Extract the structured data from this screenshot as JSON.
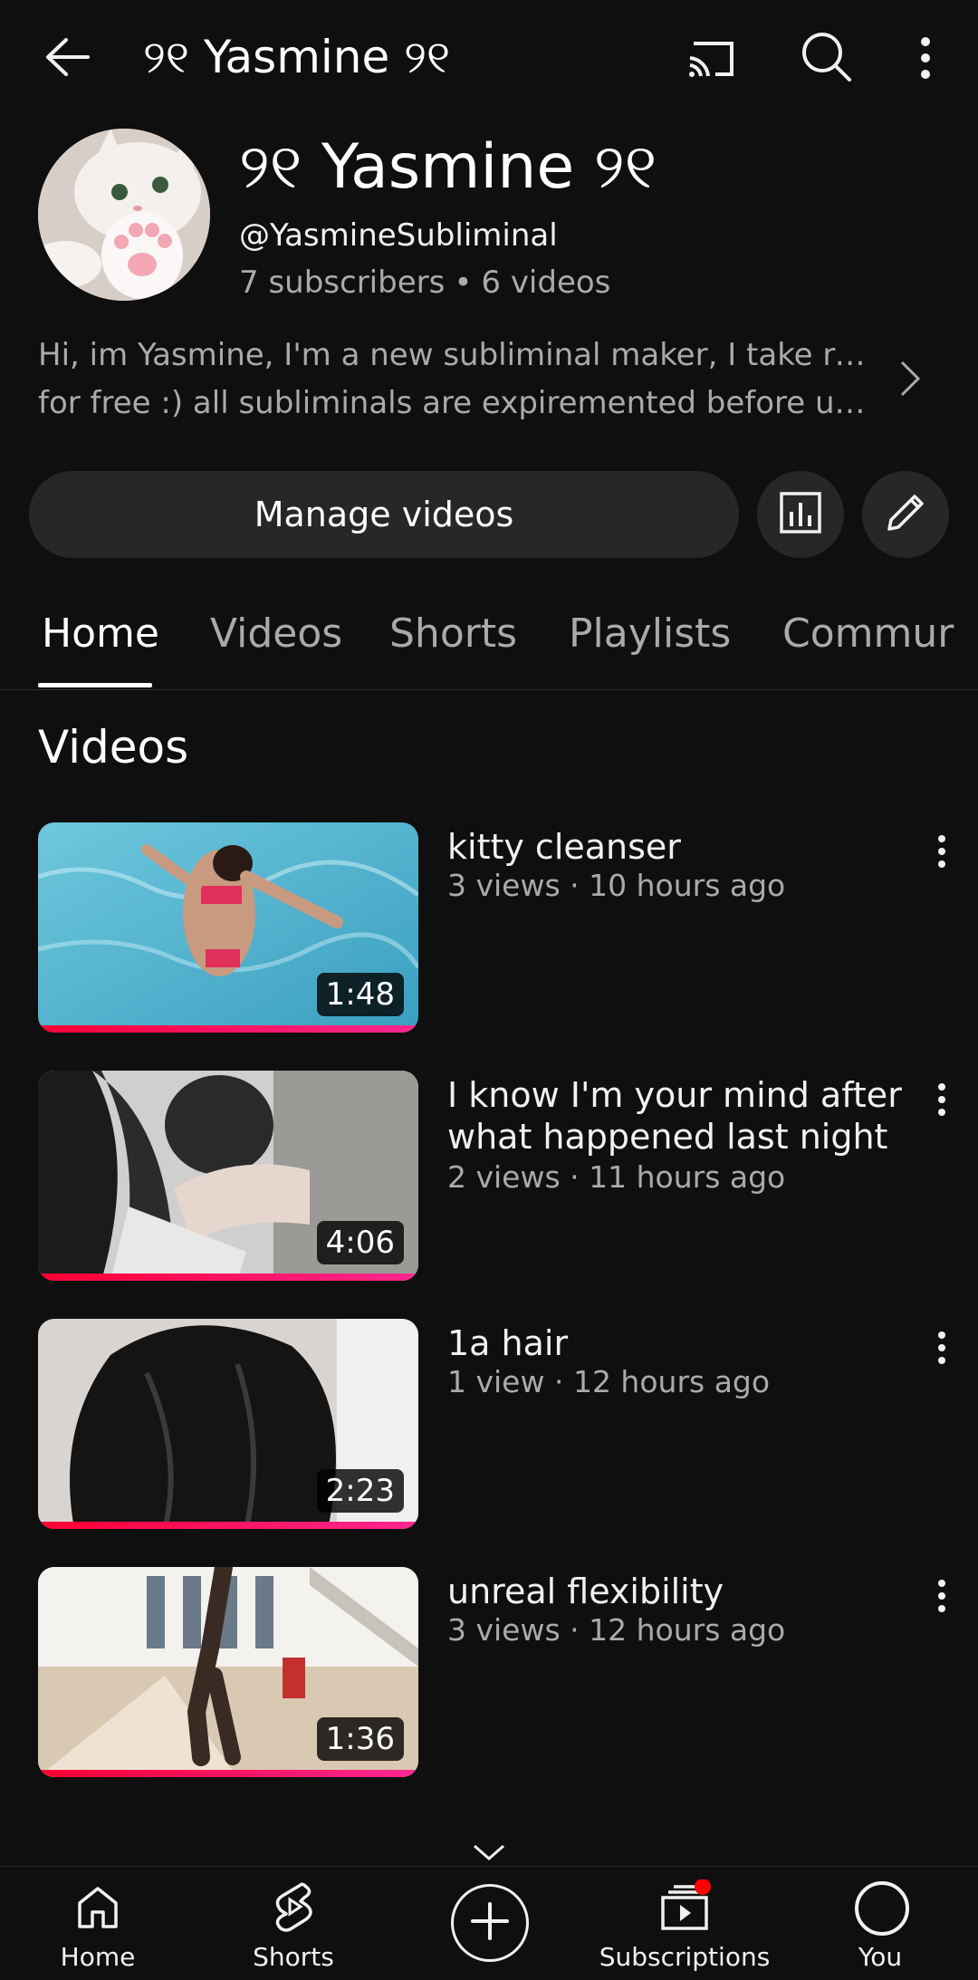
{
  "header": {
    "title": "୨୧ Yasmine ୨୧",
    "icons": [
      "back-arrow-icon",
      "cast-icon",
      "search-icon",
      "more-vert-icon"
    ]
  },
  "channel": {
    "name": "୨୧ Yasmine ୨୧",
    "handle": "@YasmineSubliminal",
    "subscribers": "7 subscribers",
    "separator": "•",
    "videos_count": "6 videos",
    "description_line1": "Hi, im Yasmine, I'm a new subliminal maker, I take requests",
    "description_line2": "for free :) all subliminals are expiremented before uploadi..."
  },
  "actions": {
    "manage_label": "Manage videos",
    "analytics_icon": "analytics-icon",
    "edit_icon": "pencil-icon"
  },
  "tabs": [
    {
      "label": "Home",
      "active": true
    },
    {
      "label": "Videos",
      "active": false
    },
    {
      "label": "Shorts",
      "active": false
    },
    {
      "label": "Playlists",
      "active": false
    },
    {
      "label": "Commur",
      "active": false
    }
  ],
  "section_title": "Videos",
  "videos": [
    {
      "title": "kitty cleanser",
      "meta": "3 views · 10 hours ago",
      "duration": "1:48",
      "watched": 1.0
    },
    {
      "title": "I know I'm your mind after what happened last night",
      "meta": "2 views · 11 hours ago",
      "duration": "4:06",
      "watched": 1.0
    },
    {
      "title": "1a hair",
      "meta": "1 view · 12 hours ago",
      "duration": "2:23",
      "watched": 1.0
    },
    {
      "title": "unreal flexibility",
      "meta": "3 views · 12 hours ago",
      "duration": "1:36",
      "watched": 1.0
    }
  ],
  "nav": {
    "home": "Home",
    "shorts": "Shorts",
    "subscriptions": "Subscriptions",
    "you": "You"
  },
  "colors": {
    "background": "#0f0f0f",
    "progress": "#ff0033",
    "notification_dot": "#ff0000"
  }
}
